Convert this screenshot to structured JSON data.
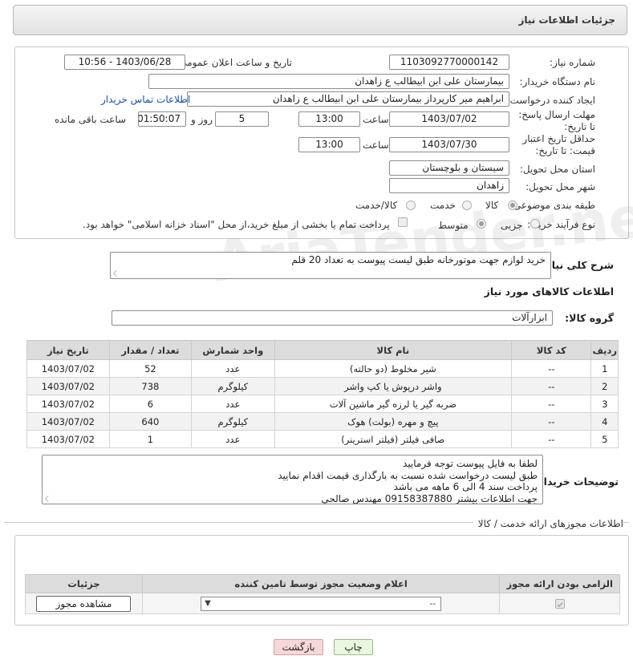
{
  "header": {
    "title": "جزئیات اطلاعات نیاز"
  },
  "form": {
    "need_number_label": "شماره نیاز:",
    "need_number": "1103092770000142",
    "announce_label": "تاریخ و ساعت اعلان عمومی:",
    "announce_value": "1403/06/28 - 10:56",
    "buyer_org_label": "نام دستگاه خریدار:",
    "buyer_org": "بیمارستان علی ابن ابیطالب  ع  زاهدان",
    "requester_label": "ایجاد کننده درخواست:",
    "requester": "ابراهیم میر کارپرداز بیمارستان علی ابن ابیطالب  ع  زاهدان",
    "contact_link": "اطلاعات تماس خریدار",
    "deadline_label": "مهلت ارسال پاسخ: تا تاریخ:",
    "deadline_date": "1403/07/02",
    "time_label": "ساعت",
    "deadline_time": "13:00",
    "days_value": "5",
    "days_label": "روز و",
    "remaining_time": "01:50:07",
    "remaining_label": "ساعت باقی مانده",
    "validity_label": "حداقل تاریخ اعتبار قیمت: تا تاریخ:",
    "validity_date": "1403/07/30",
    "validity_time": "13:00",
    "province_label": "استان محل تحویل:",
    "province": "سیستان و بلوچستان",
    "city_label": "شهر محل تحویل:",
    "city": "زاهدان",
    "category_label": "طبقه بندی موضوعی:",
    "category_options": [
      "کالا",
      "خدمت",
      "کالا/خدمت"
    ],
    "process_label": "نوع فرآیند خرید :",
    "process_options": [
      "جزیی",
      "متوسط"
    ],
    "payment_note": "پرداخت تمام یا بخشی از مبلغ خرید،از محل \"اسناد خزانه اسلامی\" خواهد بود."
  },
  "description": {
    "label": "شرح کلی نیاز:",
    "value": "خرید لوازم جهت موتورخانه طبق لیست پیوست به تعداد 20 قلم"
  },
  "goods": {
    "section_title": "اطلاعات کالاهای مورد نیاز",
    "group_label": "گروه کالا:",
    "group_value": "ابزارآلات",
    "columns": [
      "ردیف",
      "کد کالا",
      "نام کالا",
      "واحد شمارش",
      "تعداد / مقدار",
      "تاریخ نیاز"
    ],
    "rows": [
      [
        "1",
        "--",
        "شیر مخلوط (دو حالته)",
        "عدد",
        "52",
        "1403/07/02"
      ],
      [
        "2",
        "--",
        "واشر درپوش یا کپ واشر",
        "کیلوگرم",
        "738",
        "1403/07/02"
      ],
      [
        "3",
        "--",
        "ضربه گیر یا لرزه گیر ماشین آلات",
        "عدد",
        "6",
        "1403/07/02"
      ],
      [
        "4",
        "--",
        "پیچ و مهره (بولت) هوک",
        "کیلوگرم",
        "640",
        "1403/07/02"
      ],
      [
        "5",
        "--",
        "صافی فیلتر (فیلتر استرینر)",
        "عدد",
        "1",
        "1403/07/02"
      ]
    ]
  },
  "buyer_notes": {
    "label": "توضیحات خریدار:",
    "lines": [
      "لطفا به فایل پیوست توجه فرمایید",
      "طبق لیست درخواست شده نسبت به بارگذاری قیمت اقدام نمایید",
      "پرداخت سند 4 الی 6 ماهه می باشد",
      "جهت اطلاعات بیشتر 09158387880 مهندس صالحی"
    ]
  },
  "licenses": {
    "section_title": "اطلاعات مجوزهای ارائه خدمت / کالا",
    "columns": [
      "الزامی بودن ارائه مجوز",
      "اعلام وضعیت مجوز توسط تامین کننده",
      "جزئیات"
    ],
    "select_value": "--",
    "view_button": "مشاهده مجوز"
  },
  "buttons": {
    "print": "چاپ",
    "back": "بازگشت"
  },
  "watermark": "AriaTender.neT",
  "colors": {
    "back_button": "#f8d7d7",
    "print_button": "#e9f7e1",
    "link": "#1a4fa8"
  }
}
